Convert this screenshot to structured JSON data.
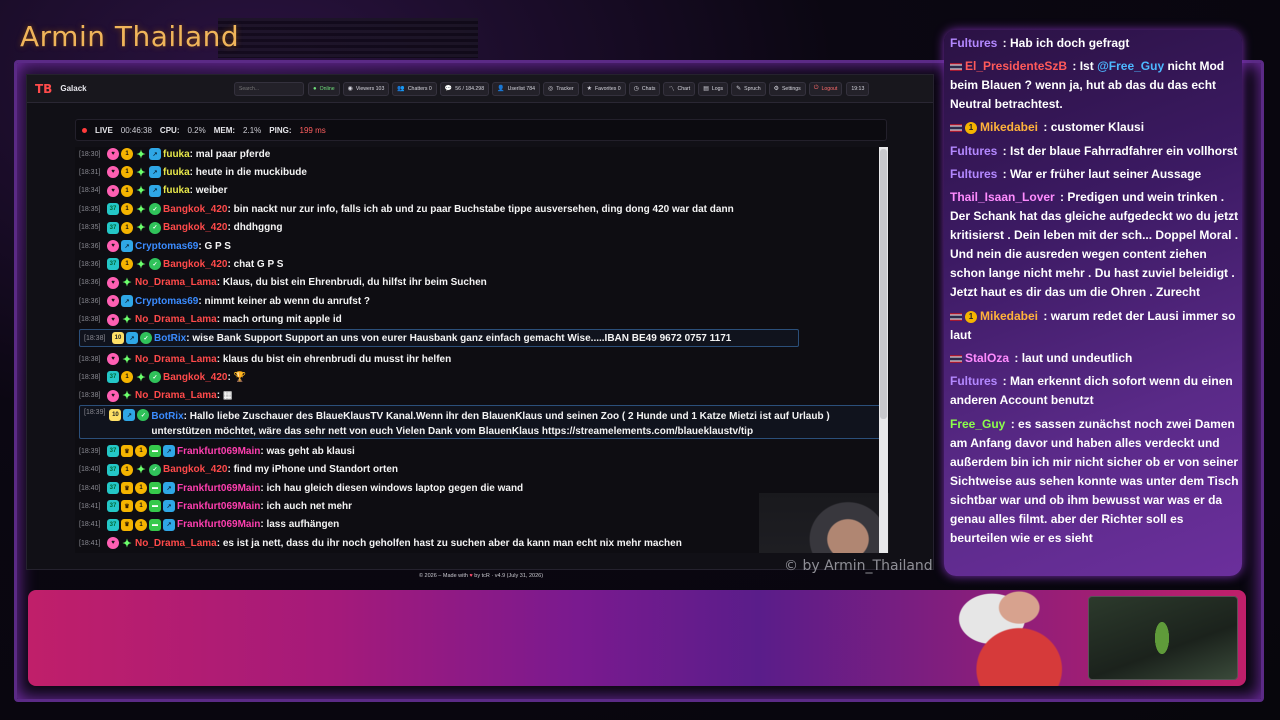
{
  "channel_title": "Armin Thailand",
  "browser": {
    "app_name": "Galack",
    "logo_text": "TB",
    "search_placeholder": "Search...",
    "nav": [
      {
        "icon": "●",
        "label": "Online"
      },
      {
        "icon": "◉",
        "label": "Viewers 103"
      },
      {
        "icon": "👥",
        "label": "Chatters 0"
      },
      {
        "icon": "💬",
        "label": "56 / 184.298"
      },
      {
        "icon": "👤",
        "label": "Userlist 784"
      },
      {
        "icon": "◎",
        "label": "Tracker"
      },
      {
        "icon": "★",
        "label": "Favorites 0"
      },
      {
        "icon": "◷",
        "label": "Chats"
      },
      {
        "icon": "〽",
        "label": "Chart"
      },
      {
        "icon": "▤",
        "label": "Logs"
      },
      {
        "icon": "✎",
        "label": "Spruch"
      },
      {
        "icon": "⚙",
        "label": "Settings"
      },
      {
        "icon": "⏻",
        "label": "Logout"
      }
    ],
    "clock": "19:13",
    "status": {
      "live_label": "LIVE",
      "live_time": "00:46:38",
      "cpu_label": "CPU:",
      "cpu_value": "0.2%",
      "mem_label": "MEM:",
      "mem_value": "2.1%",
      "ping_label": "PING:",
      "ping_value": "199 ms"
    },
    "footer_pre": "© 2026 – Made with",
    "footer_post": "by tcR · v4.9 (July 31, 2026)"
  },
  "chat": [
    {
      "ts": "[18:30]",
      "badges": [
        "pink",
        "gold",
        "green",
        "blue"
      ],
      "user": "fuuka",
      "color": "#e6e64a",
      "text": "mal paar pferde"
    },
    {
      "ts": "[18:31]",
      "badges": [
        "pink",
        "gold",
        "green",
        "blue"
      ],
      "user": "fuuka",
      "color": "#e6e64a",
      "text": "heute in die muckibude"
    },
    {
      "ts": "[18:34]",
      "badges": [
        "pink",
        "gold",
        "green",
        "blue"
      ],
      "user": "fuuka",
      "color": "#e6e64a",
      "text": "weiber"
    },
    {
      "ts": "[18:35]",
      "badges": [
        "teal",
        "gold",
        "green",
        "verify"
      ],
      "user": "Bangkok_420",
      "color": "#ff4a4a",
      "text": "bin nackt nur zur info, falls ich ab und zu paar Buchstabe tippe ausversehen, ding dong 420 war dat dann"
    },
    {
      "ts": "[18:35]",
      "badges": [
        "teal",
        "gold",
        "green",
        "verify"
      ],
      "user": "Bangkok_420",
      "color": "#ff4a4a",
      "text": "dhdhggng"
    },
    {
      "ts": "[18:36]",
      "badges": [
        "pink",
        "blue"
      ],
      "user": "Cryptomas69",
      "color": "#3b8cff",
      "text": "G P S"
    },
    {
      "ts": "[18:36]",
      "badges": [
        "teal",
        "gold",
        "green",
        "verify"
      ],
      "user": "Bangkok_420",
      "color": "#ff4a4a",
      "text": "chat G P S"
    },
    {
      "ts": "[18:36]",
      "badges": [
        "pink",
        "green"
      ],
      "user": "No_Drama_Lama",
      "color": "#ff4a4a",
      "text": "Klaus, du bist ein Ehrenbrudi, du hilfst ihr beim Suchen"
    },
    {
      "ts": "[18:36]",
      "badges": [
        "pink",
        "blue"
      ],
      "user": "Cryptomas69",
      "color": "#3b8cff",
      "text": "nimmt keiner ab wenn du anrufst ?"
    },
    {
      "ts": "[18:38]",
      "badges": [
        "pink",
        "green"
      ],
      "user": "No_Drama_Lama",
      "color": "#ff4a4a",
      "text": "mach ortung mit apple id"
    },
    {
      "ts": "[18:38]",
      "badges": [
        "yellow",
        "blue",
        "verify"
      ],
      "user": "BotRix",
      "color": "#3b8cff",
      "text": "wise Bank Support Support an uns von eurer Hausbank ganz einfach gemacht Wise.....IBAN BE49 9672 0757 1171",
      "bot": true
    },
    {
      "ts": "[18:38]",
      "badges": [
        "pink",
        "green"
      ],
      "user": "No_Drama_Lama",
      "color": "#ff4a4a",
      "text": "klaus du bist ein ehrenbrudi du musst ihr helfen"
    },
    {
      "ts": "[18:38]",
      "badges": [
        "teal",
        "gold",
        "green",
        "verify"
      ],
      "user": "Bangkok_420",
      "color": "#ff4a4a",
      "text": "🏆"
    },
    {
      "ts": "[18:38]",
      "badges": [
        "pink",
        "green"
      ],
      "user": "No_Drama_Lama",
      "color": "#ff4a4a",
      "text": "▦"
    },
    {
      "ts": "[18:39]",
      "badges": [
        "yellow",
        "blue",
        "verify"
      ],
      "user": "BotRix",
      "color": "#3b8cff",
      "text": "Hallo liebe Zuschauer des BlaueKlausTV Kanal.Wenn ihr den BlauenKlaus und seinen Zoo ( 2 Hunde und 1 Katze Mietzi ist auf Urlaub ) unterstützen möchtet, wäre das sehr nett von euch Vielen Dank vom BlauenKlaus https://streamelements.com/blaueklaustv/tip",
      "bot": true,
      "big": true
    },
    {
      "ts": "[18:39]",
      "badges": [
        "teal",
        "crown",
        "gold",
        "mod",
        "blue"
      ],
      "user": "Frankfurt069Main",
      "color": "#ff3fb0",
      "text": "was geht ab klausi"
    },
    {
      "ts": "[18:40]",
      "badges": [
        "teal",
        "gold",
        "green",
        "verify"
      ],
      "user": "Bangkok_420",
      "color": "#ff4a4a",
      "text": "find my iPhone und Standort orten"
    },
    {
      "ts": "[18:40]",
      "badges": [
        "teal",
        "crown",
        "gold",
        "mod",
        "blue"
      ],
      "user": "Frankfurt069Main",
      "color": "#ff3fb0",
      "text": "ich hau gleich diesen windows laptop gegen die wand"
    },
    {
      "ts": "[18:41]",
      "badges": [
        "teal",
        "crown",
        "gold",
        "mod",
        "blue"
      ],
      "user": "Frankfurt069Main",
      "color": "#ff3fb0",
      "text": "ich auch net mehr"
    },
    {
      "ts": "[18:41]",
      "badges": [
        "teal",
        "crown",
        "gold",
        "mod",
        "blue"
      ],
      "user": "Frankfurt069Main",
      "color": "#ff3fb0",
      "text": "lass aufhängen"
    },
    {
      "ts": "[18:41]",
      "badges": [
        "pink",
        "green"
      ],
      "user": "No_Drama_Lama",
      "color": "#ff4a4a",
      "text": "es ist ja nett, dass du ihr noch geholfen hast zu suchen aber da kann man echt nix mehr machen"
    }
  ],
  "watermark": "© by Armin_Thailand",
  "side_chat": [
    {
      "user": "Fultures",
      "cls": "u-fut",
      "flag": false,
      "coin": false,
      "text": "Hab ich doch gefragt"
    },
    {
      "user": "El_PresidenteSzB",
      "cls": "u-red",
      "flag": true,
      "coin": false,
      "pre": "Ist ",
      "mention": "@Free_Guy",
      "text": " nicht Mod beim Blauen ? wenn ja, hut ab das du das echt Neutral betrachtest."
    },
    {
      "user": "Mikedabei",
      "cls": "u-org",
      "flag": true,
      "coin": true,
      "text": "customer Klausi"
    },
    {
      "user": "Fultures",
      "cls": "u-fut",
      "flag": false,
      "coin": false,
      "text": "Ist der blaue Fahrradfahrer ein vollhorst"
    },
    {
      "user": "Fultures",
      "cls": "u-fut",
      "flag": false,
      "coin": false,
      "text": "War er früher laut seiner Aussage"
    },
    {
      "user": "Thail_Isaan_Lover",
      "cls": "u-thai",
      "flag": false,
      "coin": false,
      "text": "Predigen und wein trinken . Der Schank hat das gleiche aufgedeckt wo du jetzt kritisierst . Dein leben mit der sch... Doppel Moral . Und nein die ausreden wegen content ziehen schon lange nicht mehr . Du hast zuviel beleidigt . Jetzt haut es dir das um die Ohren . Zurecht"
    },
    {
      "user": "Mikedabei",
      "cls": "u-org",
      "flag": true,
      "coin": true,
      "text": "warum redet der Lausi immer so laut"
    },
    {
      "user": "StalOza",
      "cls": "u-stal",
      "flag": true,
      "coin": false,
      "text": "laut und undeutlich"
    },
    {
      "user": "Fultures",
      "cls": "u-fut",
      "flag": false,
      "coin": false,
      "text": "Man erkennt dich sofort wenn du einen anderen Account benutzt"
    },
    {
      "user": "Free_Guy",
      "cls": "u-free",
      "flag": false,
      "coin": false,
      "text": "es sassen zunächst noch zwei Damen am Anfang davor und haben alles verdeckt und außerdem bin ich mir nicht sicher ob er von seiner Sichtweise aus sehen konnte was unter dem Tisch sichtbar war und ob ihm bewusst war was er da genau alles filmt. aber der Richter soll es beurteilen wie er es sieht"
    }
  ]
}
